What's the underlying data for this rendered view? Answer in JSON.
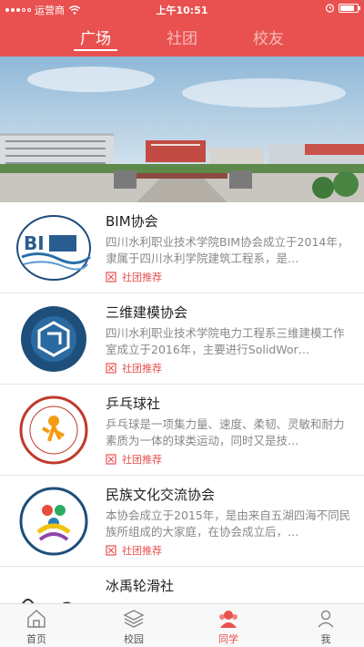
{
  "status_bar": {
    "carrier": "运营商",
    "time": "上午10:51"
  },
  "colors": {
    "accent": "#e8514f"
  },
  "top_tabs": [
    {
      "label": "广场",
      "active": true
    },
    {
      "label": "社团",
      "active": false
    },
    {
      "label": "校友",
      "active": false
    }
  ],
  "feed": [
    {
      "title": "BIM协会",
      "desc": "四川水利职业技术学院BIM协会成立于2014年，隶属于四川水利学院建筑工程系，是…",
      "tag": "社团推荐",
      "thumb_icon": "bim-logo-icon"
    },
    {
      "title": "三维建模协会",
      "desc": "四川水利职业技术学院电力工程系三维建模工作室成立于2016年，主要进行SolidWor…",
      "tag": "社团推荐",
      "thumb_icon": "3d-modeling-logo-icon"
    },
    {
      "title": "乒乓球社",
      "desc": "乒乓球是一项集力量、速度、柔韧、灵敏和耐力素质为一体的球类运动，同时又是技…",
      "tag": "社团推荐",
      "thumb_icon": "pingpong-logo-icon"
    },
    {
      "title": "民族文化交流协会",
      "desc": "本协会成立于2015年，是由来自五湖四海不同民族所组成的大家庭，在协会成立后，…",
      "tag": "社团推荐",
      "thumb_icon": "ethnic-culture-logo-icon"
    },
    {
      "title": "冰禹轮滑社",
      "desc": "",
      "tag": "",
      "thumb_icon": "skating-logo-icon"
    }
  ],
  "bottom_tabs": [
    {
      "label": "首页",
      "icon": "home-icon",
      "active": false
    },
    {
      "label": "校园",
      "icon": "layers-icon",
      "active": false
    },
    {
      "label": "同学",
      "icon": "classmates-icon",
      "active": true
    },
    {
      "label": "我",
      "icon": "person-icon",
      "active": false
    }
  ]
}
